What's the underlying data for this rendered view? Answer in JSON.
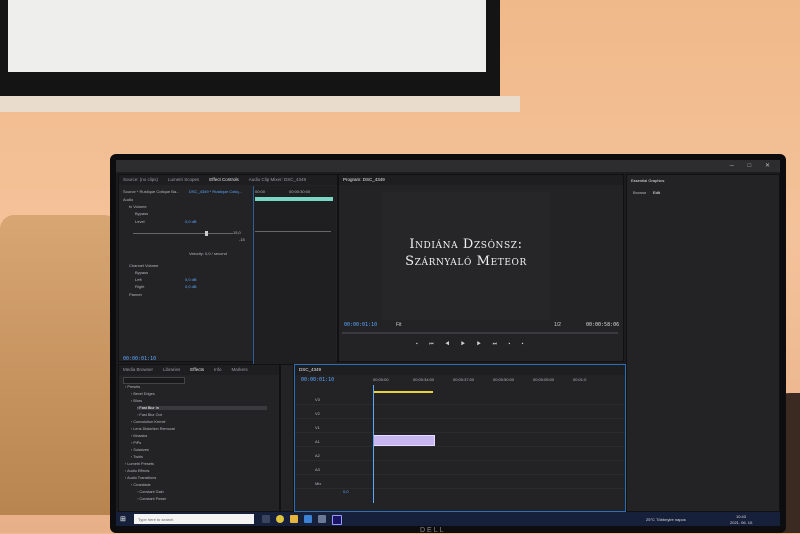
{
  "program_monitor": {
    "tab_label": "Program: DSC_4349",
    "title_line1": "Indiána Dzsónsz:",
    "title_line2": "Szárnyaló Meteor",
    "timecode_current": "00:00:01:10",
    "fit_label": "Fit",
    "ratio_label": "1/2",
    "timecode_duration": "00:00:58:06"
  },
  "source_panel": {
    "tabs": [
      "Source: (no clips)",
      "Lumetri Scopes",
      "Effect Controls",
      "Audio Clip Mixer: DSC_4349"
    ],
    "active_tab": "Effect Controls",
    "source_label": "Source * Rustique Cotique Ba...",
    "clip_label": "DSC_4349 * Rustique Cotiq...",
    "ruler_start": "00:00",
    "ruler_mid": "00:00:30:00",
    "section_audio": "Audio",
    "volume_label": "Volume",
    "bypass_label": "Bypass",
    "level_label": "Level",
    "level_value": "0,0 dB",
    "range_high": "15,0",
    "range_low": "-15",
    "velocity_label": "Velocity: 0,0 / second",
    "channel_volume_label": "Channel Volume",
    "left_label": "Left",
    "left_value": "0,0 dB",
    "right_label": "Right",
    "right_value": "0,0 dB",
    "panner_label": "Panner",
    "footer_timecode": "00:00:01:10"
  },
  "essential_graphics": {
    "title": "Essential Graphics",
    "tabs": [
      "Browse",
      "Edit"
    ],
    "active_tab": "Edit"
  },
  "effects_panel": {
    "tabs": [
      "Media Browser",
      "Libraries",
      "Effects",
      "Info",
      "Markers"
    ],
    "active_tab": "Effects",
    "items": [
      {
        "label": "Presets",
        "level": 0
      },
      {
        "label": "Bevel Edges",
        "level": 1
      },
      {
        "label": "Blurs",
        "level": 1
      },
      {
        "label": "Fast Blur In",
        "level": 2,
        "selected": true
      },
      {
        "label": "Fast Blur Out",
        "level": 2
      },
      {
        "label": "Convolution Kernel",
        "level": 1
      },
      {
        "label": "Lens Distortion Removal",
        "level": 1
      },
      {
        "label": "Mosaics",
        "level": 1
      },
      {
        "label": "PiPs",
        "level": 1
      },
      {
        "label": "Solarizes",
        "level": 1
      },
      {
        "label": "Twirls",
        "level": 1
      },
      {
        "label": "Lumetri Presets",
        "level": 0
      },
      {
        "label": "Audio Effects",
        "level": 0
      },
      {
        "label": "Audio Transitions",
        "level": 0
      },
      {
        "label": "Crossfade",
        "level": 1
      },
      {
        "label": "Constant Gain",
        "level": 2
      },
      {
        "label": "Constant Power",
        "level": 2
      }
    ]
  },
  "timeline": {
    "tab_label": "DSC_4349",
    "timecode": "00:00:01:10",
    "ruler_labels": [
      "00:00:00",
      "00:00:34:00",
      "00:00:37:00",
      "00:00:50:00",
      "00:00:05:00",
      "00:01:0"
    ],
    "tracks": [
      "V3",
      "V2",
      "V1",
      "A1",
      "A2",
      "A3",
      "Mix"
    ],
    "mix_value": "0,0"
  },
  "taskbar": {
    "search_placeholder": "Type here to search",
    "weather": "25°C  Többnyire napos",
    "time": "10:43",
    "date": "2021. 06. 10."
  },
  "monitor_brand": "DELL"
}
